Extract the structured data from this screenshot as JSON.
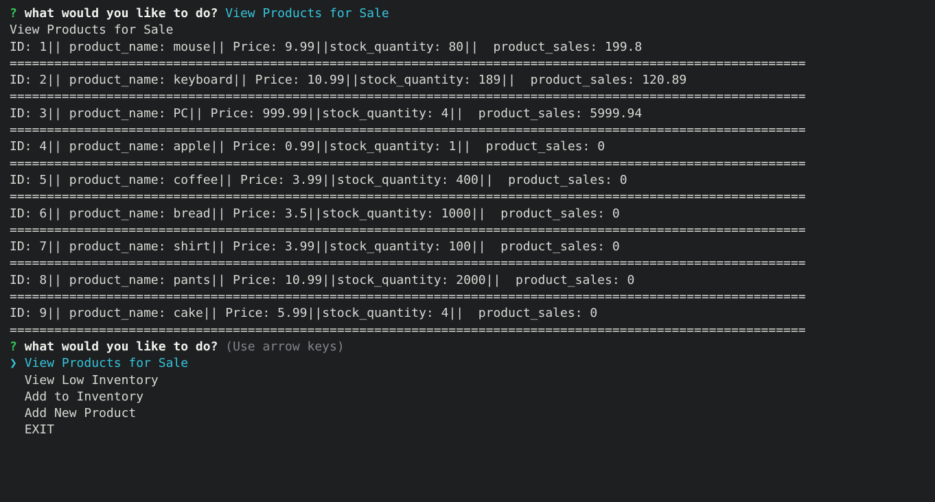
{
  "prompt": {
    "marker": "?",
    "question": "what would you like to do?",
    "answer": "View Products for Sale",
    "hint": "(Use arrow keys)"
  },
  "header_echo": "View Products for Sale",
  "labels": {
    "id": "ID: ",
    "name": "|| product_name: ",
    "price": "|| Price: ",
    "stock": "||stock_quantity: ",
    "sales": "||  product_sales: "
  },
  "separator": "===========================================================================================================",
  "products": [
    {
      "id": "1",
      "name": "mouse",
      "price": "9.99",
      "stock": "80",
      "sales": "199.8"
    },
    {
      "id": "2",
      "name": "keyboard",
      "price": "10.99",
      "stock": "189",
      "sales": "120.89"
    },
    {
      "id": "3",
      "name": "PC",
      "price": "999.99",
      "stock": "4",
      "sales": "5999.94"
    },
    {
      "id": "4",
      "name": "apple",
      "price": "0.99",
      "stock": "1",
      "sales": "0"
    },
    {
      "id": "5",
      "name": "coffee",
      "price": "3.99",
      "stock": "400",
      "sales": "0"
    },
    {
      "id": "6",
      "name": "bread",
      "price": "3.5",
      "stock": "1000",
      "sales": "0"
    },
    {
      "id": "7",
      "name": "shirt",
      "price": "3.99",
      "stock": "100",
      "sales": "0"
    },
    {
      "id": "8",
      "name": "pants",
      "price": "10.99",
      "stock": "2000",
      "sales": "0"
    },
    {
      "id": "9",
      "name": "cake",
      "price": "5.99",
      "stock": "4",
      "sales": "0"
    }
  ],
  "menu": {
    "pointer": "❯",
    "indent": "  ",
    "items": [
      {
        "label": "View Products for Sale",
        "selected": true
      },
      {
        "label": "View Low Inventory",
        "selected": false
      },
      {
        "label": "Add to Inventory",
        "selected": false
      },
      {
        "label": "Add New Product",
        "selected": false
      },
      {
        "label": "EXIT",
        "selected": false
      }
    ]
  }
}
